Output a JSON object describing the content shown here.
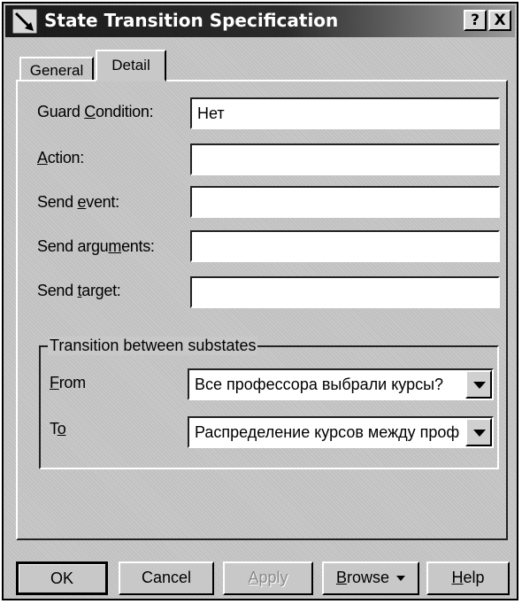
{
  "window": {
    "title": "State Transition Specification",
    "help_button": "?",
    "close_button": "X"
  },
  "tabs": [
    {
      "label": "General",
      "active": false
    },
    {
      "label": "Detail",
      "active": true
    }
  ],
  "fields": {
    "guard_condition": {
      "label_pre": "Guard ",
      "label_key": "C",
      "label_post": "ondition:",
      "value": "Нет"
    },
    "action": {
      "label_pre": "",
      "label_key": "A",
      "label_post": "ction:",
      "value": ""
    },
    "send_event": {
      "label_pre": "Send ",
      "label_key": "e",
      "label_post": "vent:",
      "value": ""
    },
    "send_arguments": {
      "label_pre": "Send argu",
      "label_key": "m",
      "label_post": "ents:",
      "value": ""
    },
    "send_target": {
      "label_pre": "Send ",
      "label_key": "t",
      "label_post": "arget:",
      "value": ""
    }
  },
  "substates": {
    "group_title": "Transition between substates",
    "from": {
      "label_key": "F",
      "label_post": "rom",
      "value": "Все профессора выбрали курсы?"
    },
    "to": {
      "label_pre": "T",
      "label_key": "o",
      "value": "Распределение курсов между проф"
    }
  },
  "buttons": {
    "ok": "OK",
    "cancel": "Cancel",
    "apply_key": "A",
    "apply_rest": "pply",
    "browse_key": "B",
    "browse_rest": "rowse",
    "help_key": "H",
    "help_rest": "elp"
  },
  "icons": {
    "title_icon": "transition-arrow-icon",
    "browse_dropdown": "dropdown-arrow-icon",
    "combo_dropdown": "dropdown-arrow-icon"
  },
  "colors": {
    "dialog_face": "#c8c8c8",
    "titlebar": "#1a1a1a",
    "field_bg": "#ffffff"
  }
}
